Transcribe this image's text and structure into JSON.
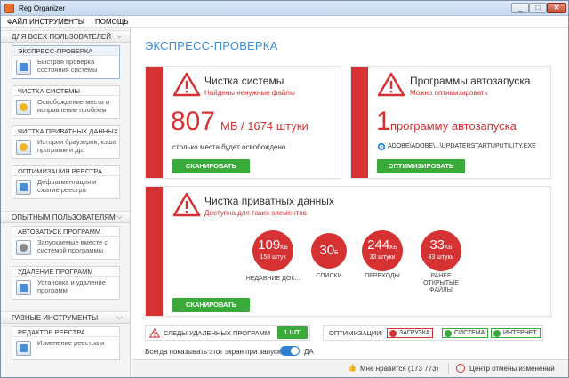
{
  "window": {
    "title": "Reg Organizer",
    "min": "_",
    "max": "□",
    "close": "✕"
  },
  "menu": [
    "ФАЙЛ",
    "ИНСТРУМЕНТЫ",
    "ПОМОЩЬ"
  ],
  "sidebar": {
    "groups": [
      {
        "title": "ДЛЯ ВСЕХ ПОЛЬЗОВАТЕЛЕЙ",
        "chev": "⌵"
      },
      {
        "title": "ОПЫТНЫМ ПОЛЬЗОВАТЕЛЯМ",
        "chev": "⌵"
      },
      {
        "title": "РАЗНЫЕ ИНСТРУМЕНТЫ",
        "chev": "⌵"
      }
    ],
    "items": [
      {
        "title": "ЭКСПРЕСС-ПРОВЕРКА",
        "desc": "Быстрая проверка состояния системы",
        "icon": "checklist-icon"
      },
      {
        "title": "ЧИСТКА СИСТЕМЫ",
        "desc": "Освобождение места и исправление проблем",
        "icon": "broom-icon"
      },
      {
        "title": "ЧИСТКА ПРИВАТНЫХ ДАННЫХ",
        "desc": "Истории браузеров, кэша программ и др.",
        "icon": "privacy-icon"
      },
      {
        "title": "ОПТИМИЗАЦИЯ РЕЕСТРА",
        "desc": "Дефрагментация и сжатие реестра",
        "icon": "registry-icon"
      },
      {
        "title": "АВТОЗАПУСК ПРОГРАММ",
        "desc": "Запускаемые вместе с системой программы",
        "icon": "startup-icon"
      },
      {
        "title": "УДАЛЕНИЕ ПРОГРАММ",
        "desc": "Установка и удаление программ",
        "icon": "uninstall-icon"
      },
      {
        "title": "РЕДАКТОР РЕЕСТРА",
        "desc": "Изменение реестра и",
        "icon": "regedit-icon"
      }
    ]
  },
  "main": {
    "title": "ЭКСПРЕСС-ПРОВЕРКА",
    "cleanup": {
      "title": "Чистка системы",
      "subtitle": "Найдены ненужные файлы",
      "value": "807",
      "unit": "МБ / 1674 штуки",
      "note": "столько места будет освобождено",
      "button": "СКАНИРОВАТЬ"
    },
    "autorun": {
      "title": "Программы автозапуска",
      "subtitle": "Можно оптимизировать",
      "value": "1",
      "unit": "программу автозапуска",
      "path": "ADOBE\\ADOBE\\...\\UPDATERSTARTUPUTILITY.EXE",
      "button": "ОПТИМИЗИРОВАТЬ"
    },
    "privacy": {
      "title": "Чистка приватных данных",
      "subtitle": "Доступна для таких элементов",
      "button": "СКАНИРОВАТЬ",
      "circles": [
        {
          "value": "109",
          "unit": "КБ",
          "sub": "158 штук",
          "label": "НЕДАВНИЕ ДОК..."
        },
        {
          "value": "30",
          "unit": "Б",
          "sub": "",
          "label": "СПИСКИ"
        },
        {
          "value": "244",
          "unit": "КБ",
          "sub": "33 штуки",
          "label": "ПЕРЕХОДЫ"
        },
        {
          "value": "33",
          "unit": "КБ",
          "sub": "83 штуки",
          "label": "РАНЕЕ ОТКРЫТЫЕ ФАЙЛЫ"
        }
      ]
    },
    "traces": {
      "label": "СЛЕДЫ УДАЛЕННЫХ ПРОГРАММ",
      "count": "1 ШТ."
    },
    "optim": {
      "label": "ОПТИМИЗАЦИИ:",
      "tags": [
        "ЗАГРУЗКА",
        "СИСТЕМА",
        "ИНТЕРНЕТ"
      ]
    },
    "show_screen": {
      "label": "Всегда показывать этот экран при запуске",
      "value": "ДА"
    }
  },
  "status": {
    "like": "Мне нравится (173 773)",
    "undo": "Центр отмены изменений"
  },
  "colors": {
    "accent": "#d63133",
    "green": "#3aaa3a",
    "blue": "#3a8ed8"
  }
}
